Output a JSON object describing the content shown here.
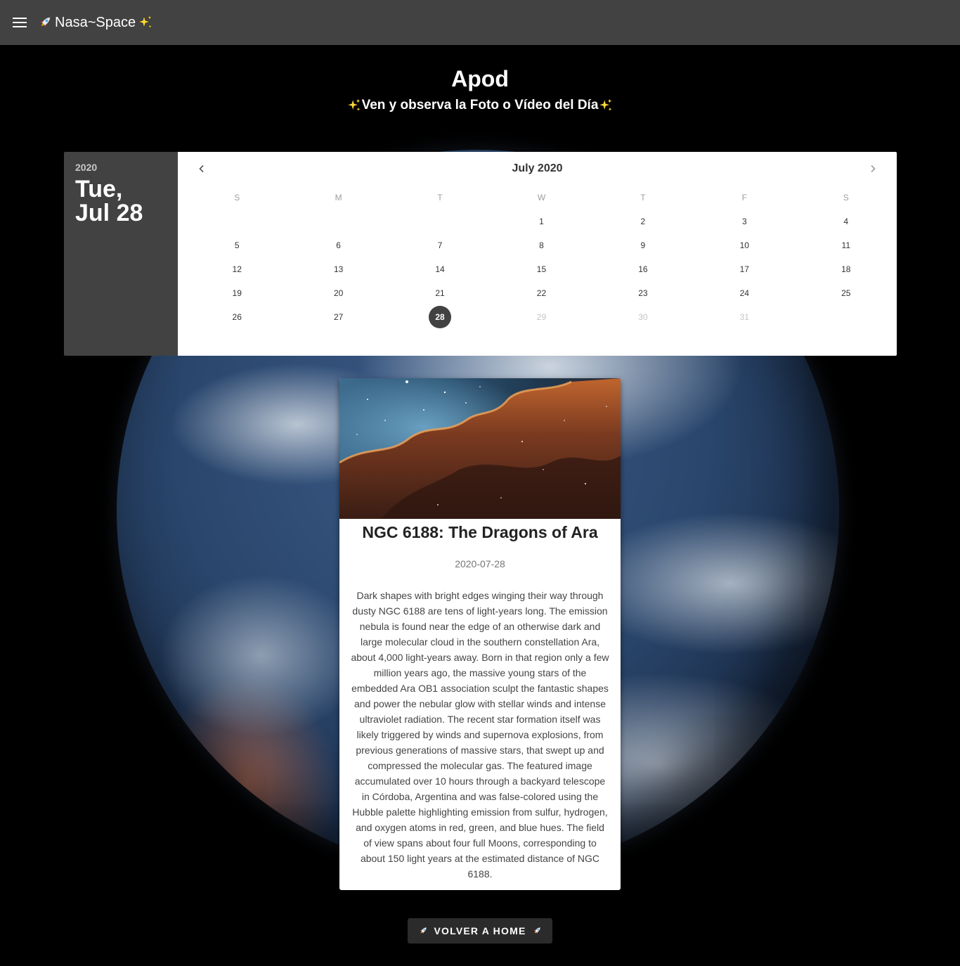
{
  "appbar": {
    "brand": "Nasa~Space",
    "icons": {
      "menu": "menu-icon",
      "left": "rocket-icon",
      "right": "sparkles-icon"
    }
  },
  "header": {
    "title": "Apod",
    "subtitle": "Ven y observa la Foto o Vídeo del Día"
  },
  "datepicker": {
    "year": "2020",
    "selected_date": "Tue, Jul 28",
    "month_label": "July 2020",
    "weekdays": [
      "S",
      "M",
      "T",
      "W",
      "T",
      "F",
      "S"
    ],
    "weeks": [
      [
        "",
        "",
        "",
        "1",
        "2",
        "3",
        "4"
      ],
      [
        "5",
        "6",
        "7",
        "8",
        "9",
        "10",
        "11"
      ],
      [
        "12",
        "13",
        "14",
        "15",
        "16",
        "17",
        "18"
      ],
      [
        "19",
        "20",
        "21",
        "22",
        "23",
        "24",
        "25"
      ],
      [
        "26",
        "27",
        "28",
        "29",
        "30",
        "31",
        ""
      ]
    ],
    "selected_day": "28",
    "disabled_days": [
      "29",
      "30",
      "31"
    ],
    "accent_color": "#424242"
  },
  "apod": {
    "title": "NGC 6188: The Dragons of Ara",
    "date": "2020-07-28",
    "explanation": "Dark shapes with bright edges winging their way through dusty NGC 6188 are tens of light-years long. The emission nebula is found near the edge of an otherwise dark and large molecular cloud in the southern constellation Ara, about 4,000 light-years away. Born in that region only a few million years ago, the massive young stars of the embedded Ara OB1 association sculpt the fantastic shapes and power the nebular glow with stellar winds and intense ultraviolet radiation. The recent star formation itself was likely triggered by winds and supernova explosions, from previous generations of massive stars, that swept up and compressed the molecular gas. The featured image accumulated over 10 hours through a backyard telescope in Córdoba, Argentina and was false-colored using the Hubble palette highlighting emission from sulfur, hydrogen, and oxygen atoms in red, green, and blue hues. The field of view spans about four full Moons, corresponding to about 150 light years at the estimated distance of NGC 6188."
  },
  "home_button": {
    "label": "VOLVER A HOME"
  },
  "colors": {
    "appbar": "#424242",
    "background": "#000000",
    "card": "#ffffff",
    "button": "#2b2b2b"
  }
}
